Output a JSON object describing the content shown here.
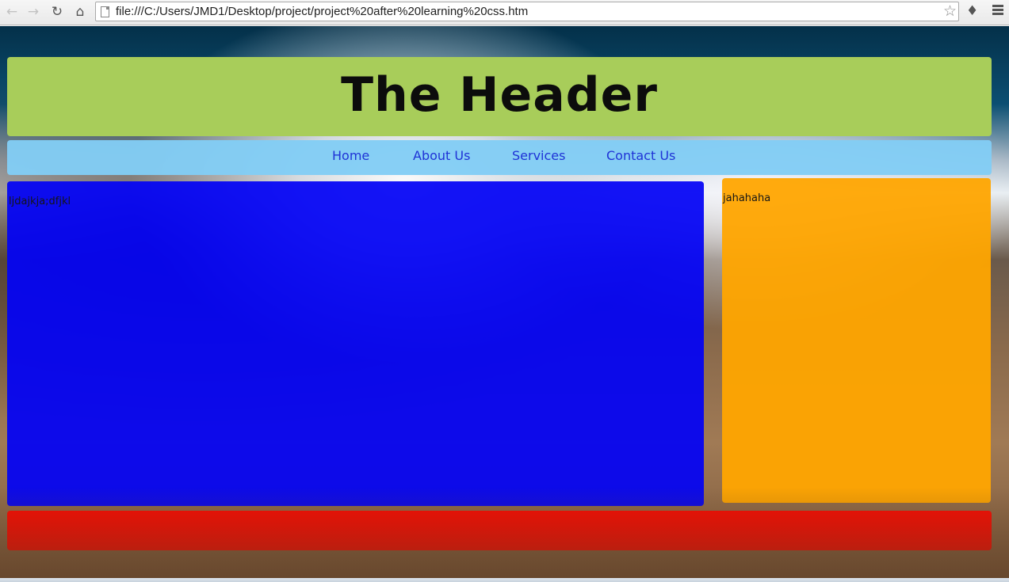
{
  "browser": {
    "url": "file:///C:/Users/JMD1/Desktop/project/project%20after%20learning%20css.htm",
    "icons": {
      "back": "back-arrow-icon",
      "forward": "forward-arrow-icon",
      "reload": "reload-icon",
      "home": "home-icon",
      "page": "page-icon",
      "bookmark": "star-icon",
      "extensions": "puzzle-icon",
      "menu": "menu-icon"
    }
  },
  "page": {
    "header_title": "The Header",
    "nav": [
      {
        "label": "Home"
      },
      {
        "label": "About Us"
      },
      {
        "label": "Services"
      },
      {
        "label": "Contact Us"
      }
    ],
    "main_text": "ljdajkja;dfjkl",
    "sidebar_text": "jahahaha",
    "colors": {
      "header": "#a8cd5a",
      "nav": "#82cdf5",
      "nav_link": "#1f33d6",
      "main": "#0202f5",
      "sidebar": "#ffa500",
      "footer": "#ff0800"
    }
  }
}
